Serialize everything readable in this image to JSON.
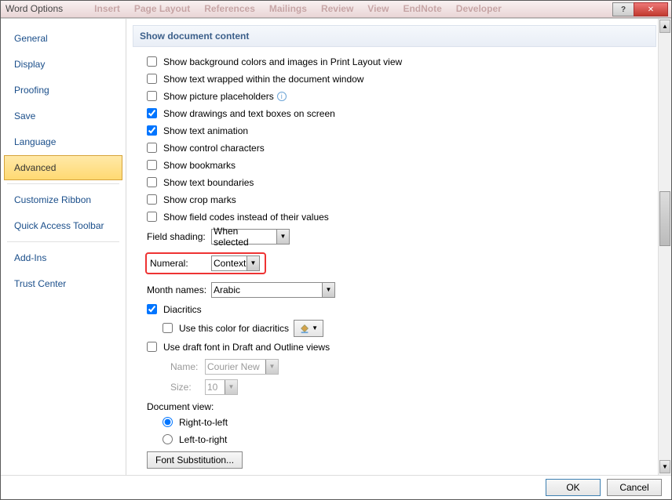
{
  "window": {
    "title": "Word Options"
  },
  "sidebar": {
    "items": [
      {
        "label": "General"
      },
      {
        "label": "Display"
      },
      {
        "label": "Proofing"
      },
      {
        "label": "Save"
      },
      {
        "label": "Language"
      },
      {
        "label": "Advanced"
      },
      {
        "label": "Customize Ribbon"
      },
      {
        "label": "Quick Access Toolbar"
      },
      {
        "label": "Add-Ins"
      },
      {
        "label": "Trust Center"
      }
    ],
    "selected": "Advanced"
  },
  "section": {
    "title": "Show document content"
  },
  "checks": {
    "bg": "Show background colors and images in Print Layout view",
    "wrap": "Show text wrapped within the document window",
    "picph": "Show picture placeholders",
    "drawings": "Show drawings and text boxes on screen",
    "anim": "Show text animation",
    "ctrl": "Show control characters",
    "bookmarks": "Show bookmarks",
    "bound": "Show text boundaries",
    "crop": "Show crop marks",
    "fieldcodes": "Show field codes instead of their values",
    "diacritics": "Diacritics",
    "diacolor": "Use this color for diacritics",
    "draftfont": "Use draft font in Draft and Outline views"
  },
  "fields": {
    "shading_label": "Field shading:",
    "shading_value": "When selected",
    "numeral_label": "Numeral:",
    "numeral_value": "Context",
    "month_label": "Month names:",
    "month_value": "Arabic",
    "name_label": "Name:",
    "name_value": "Courier New",
    "size_label": "Size:",
    "size_value": "10",
    "docview_label": "Document view:",
    "rtl": "Right-to-left",
    "ltr": "Left-to-right",
    "fontsub": "Font Substitution..."
  },
  "footer": {
    "ok": "OK",
    "cancel": "Cancel"
  }
}
